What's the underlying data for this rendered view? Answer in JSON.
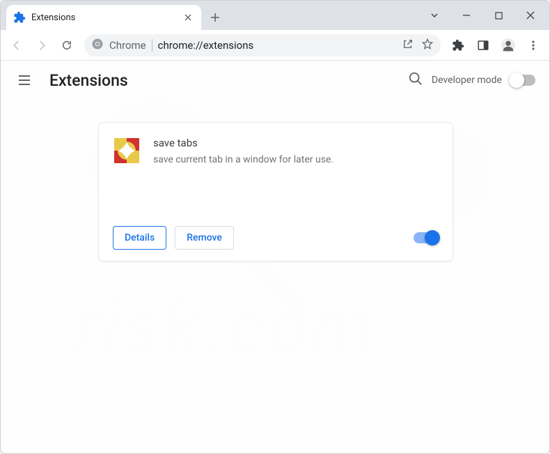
{
  "tab": {
    "title": "Extensions"
  },
  "omnibox": {
    "prefix": "Chrome",
    "url": "chrome://extensions"
  },
  "page": {
    "title": "Extensions",
    "developer_mode_label": "Developer mode",
    "developer_mode_on": false
  },
  "extension": {
    "name": "save tabs",
    "description": "save current tab in a window for later use.",
    "details_label": "Details",
    "remove_label": "Remove",
    "enabled": true
  }
}
